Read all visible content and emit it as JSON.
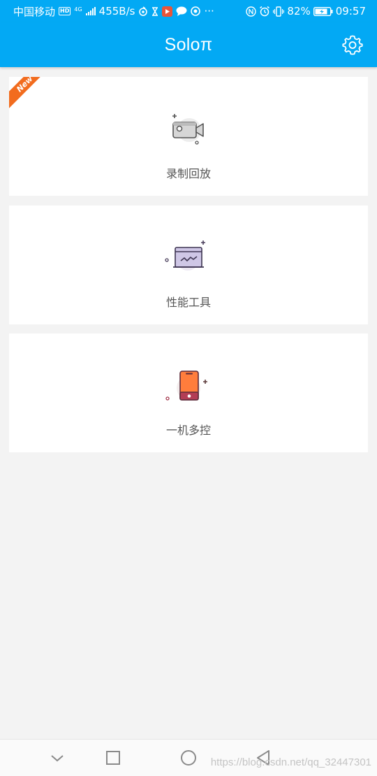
{
  "status_bar": {
    "carrier": "中国移动",
    "hd": "HD",
    "network": "4G",
    "speed": "455B/s",
    "more": "···",
    "battery": "82%",
    "time": "09:57"
  },
  "app_bar": {
    "title": "Soloπ"
  },
  "cards": [
    {
      "label": "录制回放",
      "badge": "New",
      "icon": "video-camera-icon"
    },
    {
      "label": "性能工具",
      "icon": "performance-chart-icon"
    },
    {
      "label": "一机多控",
      "icon": "smartphone-icon"
    }
  ],
  "watermark": "https://blog.csdn.net/qq_32447301",
  "colors": {
    "primary": "#03a9f4",
    "badge": "#f26c1e",
    "background": "#f3f3f3",
    "card": "#ffffff",
    "label": "#555555"
  }
}
